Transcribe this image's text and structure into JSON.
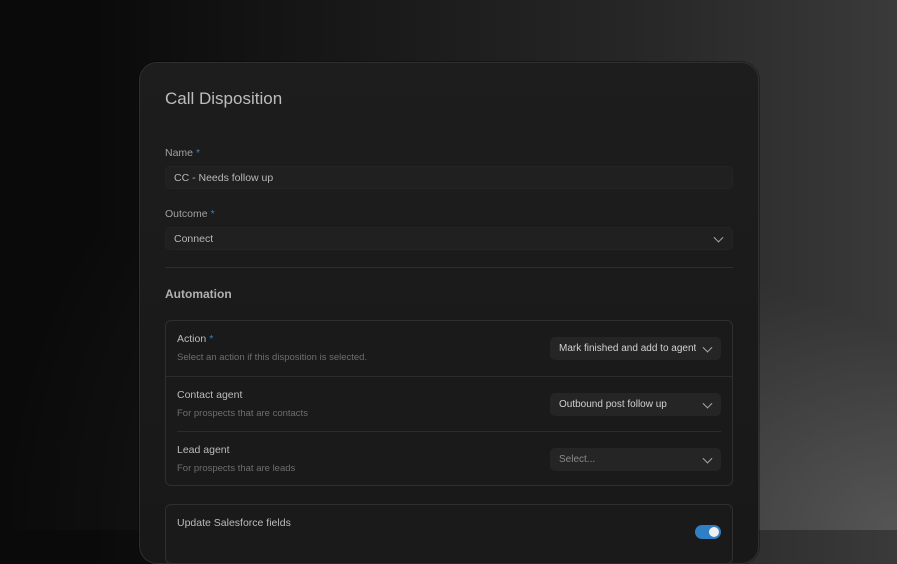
{
  "card": {
    "title": "Call Disposition",
    "name_field": {
      "label": "Name",
      "required": "*",
      "value": "CC - Needs follow up"
    },
    "outcome_field": {
      "label": "Outcome",
      "required": "*",
      "value": "Connect"
    },
    "automation": {
      "title": "Automation",
      "rows": [
        {
          "title": "Action",
          "required": "*",
          "desc": "Select an action if this disposition is selected.",
          "value": "Mark finished and add to agent"
        },
        {
          "title": "Contact agent",
          "required": "",
          "desc": "For prospects that are contacts",
          "value": "Outbound post follow up"
        },
        {
          "title": "Lead agent",
          "required": "",
          "desc": "For prospects that are leads",
          "value": "Select..."
        }
      ]
    },
    "salesforce": {
      "title": "Update Salesforce fields",
      "enabled": true
    },
    "colors": {
      "accent": "#2f7fc4",
      "required": "#3a7fb8"
    }
  }
}
